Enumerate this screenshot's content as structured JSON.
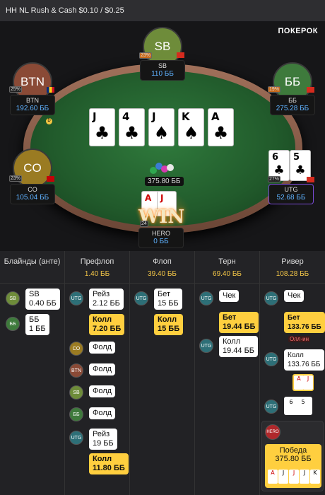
{
  "header": {
    "title": "HH NL Rush & Cash $0.10 / $0.25",
    "brand": "ПОКЕРОК"
  },
  "seats": {
    "sb": {
      "avatar": "SB",
      "name": "SB",
      "stack": "110 ББ",
      "pct": "23%"
    },
    "btn": {
      "avatar": "BTN",
      "name": "BTN",
      "stack": "192.60 ББ",
      "pct": "25%"
    },
    "bb": {
      "avatar": "ББ",
      "name": "ББ",
      "stack": "275.28 ББ",
      "pct": "19%"
    },
    "co": {
      "avatar": "CO",
      "name": "CO",
      "stack": "105.04 ББ",
      "pct": "23%"
    },
    "utg": {
      "name": "UTG",
      "stack": "52.68 ББ",
      "pct": "27%",
      "cards": [
        "6",
        "5"
      ]
    },
    "hero": {
      "name": "HERO",
      "stack": "0 ББ",
      "pct": "24",
      "cards": [
        "A",
        "J"
      ]
    }
  },
  "board": [
    {
      "rank": "J",
      "suit": "♣"
    },
    {
      "rank": "4",
      "suit": "♣"
    },
    {
      "rank": "J",
      "suit": "♠"
    },
    {
      "rank": "K",
      "suit": "♠"
    },
    {
      "rank": "A",
      "suit": "♣"
    }
  ],
  "pot": "375.80 ББ",
  "win_label": "WIN",
  "dealer_mark": "D",
  "history": {
    "columns": [
      {
        "title": "Блайнды (анте)",
        "amount": ""
      },
      {
        "title": "Префлоп",
        "amount": "1.40 ББ"
      },
      {
        "title": "Флоп",
        "amount": "39.40 ББ"
      },
      {
        "title": "Терн",
        "amount": "69.40 ББ"
      },
      {
        "title": "Ривер",
        "amount": "108.28 ББ"
      }
    ],
    "blinds": [
      {
        "player": "SB",
        "line1": "SB",
        "line2": "0.40 ББ"
      },
      {
        "player": "ББ",
        "line1": "ББ",
        "line2": "1 ББ"
      }
    ],
    "preflop": [
      {
        "player": "UTG",
        "line1": "Рейз",
        "line2": "2.12 ББ"
      },
      {
        "line1": "Колл",
        "line2": "7.20 ББ"
      },
      {
        "player": "CO",
        "line1": "Фолд"
      },
      {
        "player": "BTN",
        "line1": "Фолд"
      },
      {
        "player": "SB",
        "line1": "Фолд"
      },
      {
        "player": "ББ",
        "line1": "Фолд"
      },
      {
        "player": "UTG",
        "line1": "Рейз",
        "line2": "19 ББ"
      },
      {
        "line1": "Колл",
        "line2": "11.80 ББ"
      }
    ],
    "flop": [
      {
        "player": "UTG",
        "line1": "Бет",
        "line2": "15 ББ"
      },
      {
        "line1": "Колл",
        "line2": "15 ББ"
      }
    ],
    "turn": [
      {
        "player": "UTG",
        "line1": "Чек"
      },
      {
        "line1": "Бет",
        "line2": "19.44 ББ"
      },
      {
        "player": "UTG",
        "line1": "Колл",
        "line2": "19.44 ББ"
      }
    ],
    "river": [
      {
        "player": "UTG",
        "line1": "Чек"
      },
      {
        "line1": "Бет",
        "line2": "133.76 ББ",
        "tag": "Олл-ин"
      },
      {
        "player": "UTG",
        "line1": "Колл",
        "line2": "133.76 ББ"
      },
      {
        "player": "UTG"
      },
      {
        "player": "HERO",
        "line1": "Победа",
        "line2": "375.80 ББ"
      }
    ]
  }
}
